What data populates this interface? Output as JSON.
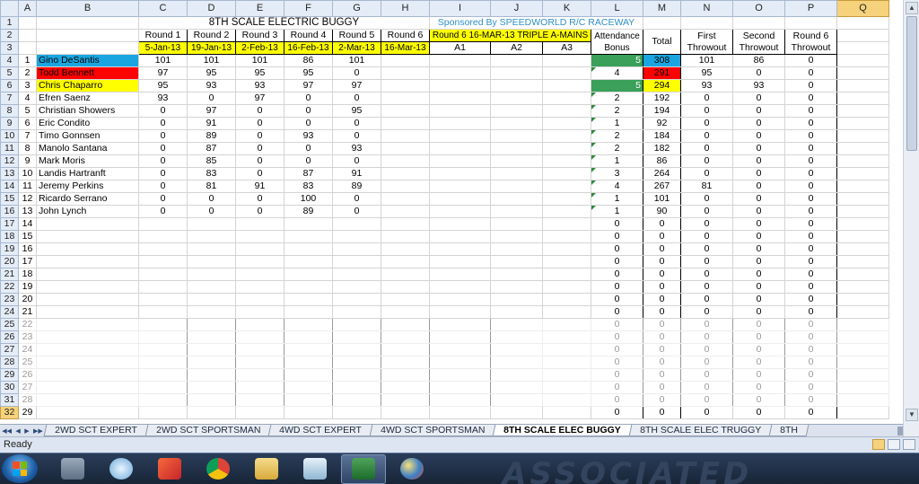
{
  "columns": [
    "",
    "A",
    "B",
    "C",
    "D",
    "E",
    "F",
    "G",
    "H",
    "I",
    "J",
    "K",
    "L",
    "M",
    "N",
    "O",
    "P",
    "Q"
  ],
  "title": "8TH SCALE ELECTRIC BUGGY",
  "sponsor": "Sponsored By SPEEDWORLD R/C RACEWAY",
  "header": {
    "rounds": [
      "Round 1",
      "Round 2",
      "Round 3",
      "Round 4",
      "Round 5",
      "Round 6"
    ],
    "dates": [
      "5-Jan-13",
      "19-Jan-13",
      "2-Feb-13",
      "16-Feb-13",
      "2-Mar-13",
      "16-Mar-13"
    ],
    "triple_title": "Round 6 16-MAR-13 TRIPLE A-MAINS",
    "triple_cols": [
      "A1",
      "A2",
      "A3"
    ],
    "attendance": "Attendance Bonus",
    "total": "Total",
    "first_throwout": "First Throwout",
    "second_throwout": "Second Throwout",
    "round6_throwout": "Round 6 Throwout"
  },
  "racers": [
    {
      "rank": "1",
      "name": "Gino DeSantis",
      "r": [
        "101",
        "101",
        "101",
        "86",
        "101"
      ],
      "bonus": "5",
      "total": "308",
      "t1": "101",
      "t2": "86",
      "t3": "0",
      "name_color": "blue",
      "bonus_color": "green",
      "total_color": "blue"
    },
    {
      "rank": "2",
      "name": "Todd Bennett",
      "r": [
        "97",
        "95",
        "95",
        "95",
        "0"
      ],
      "bonus": "4",
      "total": "291",
      "t1": "95",
      "t2": "0",
      "t3": "0",
      "name_color": "red",
      "bonus_color": "",
      "total_color": "red"
    },
    {
      "rank": "3",
      "name": "Chris Chaparro",
      "r": [
        "95",
        "93",
        "93",
        "97",
        "97"
      ],
      "bonus": "5",
      "total": "294",
      "t1": "93",
      "t2": "93",
      "t3": "0",
      "name_color": "yellow",
      "bonus_color": "green",
      "total_color": "yellow"
    },
    {
      "rank": "4",
      "name": "Efren Saenz",
      "r": [
        "93",
        "0",
        "97",
        "0",
        "0"
      ],
      "bonus": "2",
      "total": "192",
      "t1": "0",
      "t2": "0",
      "t3": "0"
    },
    {
      "rank": "5",
      "name": "Christian Showers",
      "r": [
        "0",
        "97",
        "0",
        "0",
        "95"
      ],
      "bonus": "2",
      "total": "194",
      "t1": "0",
      "t2": "0",
      "t3": "0"
    },
    {
      "rank": "6",
      "name": "Eric Condito",
      "r": [
        "0",
        "91",
        "0",
        "0",
        "0"
      ],
      "bonus": "1",
      "total": "92",
      "t1": "0",
      "t2": "0",
      "t3": "0"
    },
    {
      "rank": "7",
      "name": "Timo Gonnsen",
      "r": [
        "0",
        "89",
        "0",
        "93",
        "0"
      ],
      "bonus": "2",
      "total": "184",
      "t1": "0",
      "t2": "0",
      "t3": "0"
    },
    {
      "rank": "8",
      "name": "Manolo Santana",
      "r": [
        "0",
        "87",
        "0",
        "0",
        "93"
      ],
      "bonus": "2",
      "total": "182",
      "t1": "0",
      "t2": "0",
      "t3": "0"
    },
    {
      "rank": "9",
      "name": "Mark Moris",
      "r": [
        "0",
        "85",
        "0",
        "0",
        "0"
      ],
      "bonus": "1",
      "total": "86",
      "t1": "0",
      "t2": "0",
      "t3": "0"
    },
    {
      "rank": "10",
      "name": "Landis Hartranft",
      "r": [
        "0",
        "83",
        "0",
        "87",
        "91"
      ],
      "bonus": "3",
      "total": "264",
      "t1": "0",
      "t2": "0",
      "t3": "0"
    },
    {
      "rank": "11",
      "name": "Jeremy Perkins",
      "r": [
        "0",
        "81",
        "91",
        "83",
        "89"
      ],
      "bonus": "4",
      "total": "267",
      "t1": "81",
      "t2": "0",
      "t3": "0"
    },
    {
      "rank": "12",
      "name": "Ricardo Serrano",
      "r": [
        "0",
        "0",
        "0",
        "100",
        "0"
      ],
      "bonus": "1",
      "total": "101",
      "t1": "0",
      "t2": "0",
      "t3": "0"
    },
    {
      "rank": "13",
      "name": "John Lynch",
      "r": [
        "0",
        "0",
        "0",
        "89",
        "0"
      ],
      "bonus": "1",
      "total": "90",
      "t1": "0",
      "t2": "0",
      "t3": "0"
    }
  ],
  "empty_ranks": [
    "14",
    "15",
    "16",
    "17",
    "18",
    "19",
    "20",
    "21",
    "22",
    "23",
    "24",
    "25",
    "26",
    "27",
    "28",
    "29"
  ],
  "empty_values": {
    "bonus": "0",
    "total": "0",
    "t1": "0",
    "t2": "0",
    "t3": "0"
  },
  "row_numbers": [
    "1",
    "2",
    "3",
    "4",
    "5",
    "6",
    "7",
    "8",
    "9",
    "10",
    "11",
    "12",
    "13",
    "14",
    "15",
    "16",
    "17",
    "18",
    "19",
    "20",
    "21",
    "22",
    "23",
    "24",
    "25",
    "26",
    "27",
    "28",
    "29",
    "30",
    "31",
    "32"
  ],
  "tabs": [
    "2WD SCT EXPERT",
    "2WD SCT SPORTSMAN",
    "4WD SCT EXPERT",
    "4WD SCT SPORTSMAN",
    "8TH SCALE ELEC BUGGY",
    "8TH SCALE ELEC TRUGGY",
    "8TH"
  ],
  "active_tab": "8TH SCALE ELEC BUGGY",
  "status": "Ready",
  "taskbar": {
    "brand": "ASSOCIATED",
    "apps": [
      "calculator-icon",
      "network-icon",
      "paint-brush-icon",
      "chrome-icon",
      "folder-icon",
      "notepad-icon",
      "excel-icon",
      "paint-icon"
    ]
  }
}
